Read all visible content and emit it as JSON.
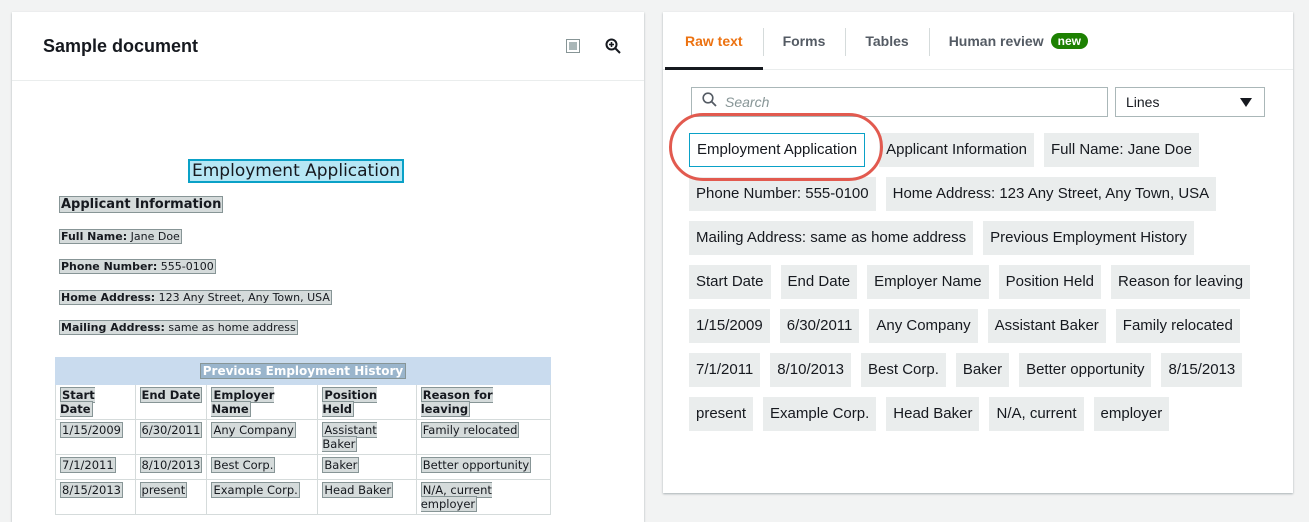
{
  "left": {
    "title": "Sample document",
    "icons": [
      "grid-icon",
      "zoom-in-icon"
    ]
  },
  "document": {
    "title": "Employment Application",
    "section": "Applicant Information",
    "fields": [
      {
        "label": "Full Name:",
        "value": "Jane Doe"
      },
      {
        "label": "Phone Number:",
        "value": "555-0100"
      },
      {
        "label": "Home Address:",
        "value": "123 Any Street, Any Town, USA"
      },
      {
        "label": "Mailing Address:",
        "value": "same as home address"
      }
    ],
    "table": {
      "caption": "Previous Employment History",
      "headers": [
        "Start Date",
        "End Date",
        "Employer Name",
        "Position Held",
        "Reason for leaving"
      ],
      "rows": [
        [
          "1/15/2009",
          "6/30/2011",
          "Any Company",
          "Assistant Baker",
          "Family relocated"
        ],
        [
          "7/1/2011",
          "8/10/2013",
          "Best Corp.",
          "Baker",
          "Better opportunity"
        ],
        [
          "8/15/2013",
          "present",
          "Example Corp.",
          "Head Baker",
          "N/A, current employer"
        ]
      ]
    }
  },
  "right": {
    "tabs": [
      {
        "label": "Raw text",
        "active": true
      },
      {
        "label": "Forms",
        "active": false
      },
      {
        "label": "Tables",
        "active": false
      },
      {
        "label": "Human review",
        "active": false,
        "badge": "new"
      }
    ],
    "search": {
      "placeholder": "Search"
    },
    "select": {
      "value": "Lines"
    },
    "chips": [
      "Employment Application",
      "Applicant Information",
      "Full Name: Jane Doe",
      "Phone Number: 555-0100",
      "Home Address: 123 Any Street, Any Town, USA",
      "Mailing Address: same as home address",
      "Previous Employment History",
      "Start Date",
      "End Date",
      "Employer Name",
      "Position Held",
      "Reason for leaving",
      "1/15/2009",
      "6/30/2011",
      "Any Company",
      "Assistant Baker",
      "Family relocated",
      "7/1/2011",
      "8/10/2013",
      "Best Corp.",
      "Baker",
      "Better opportunity",
      "8/15/2013",
      "present",
      "Example Corp.",
      "Head Baker",
      "N/A, current",
      "employer"
    ],
    "selected_chip": 0
  },
  "colors": {
    "accent_tab": "#ec7211",
    "badge": "#1d8102",
    "selection_border": "#0aa1c7",
    "callout": "#e25a4f"
  }
}
